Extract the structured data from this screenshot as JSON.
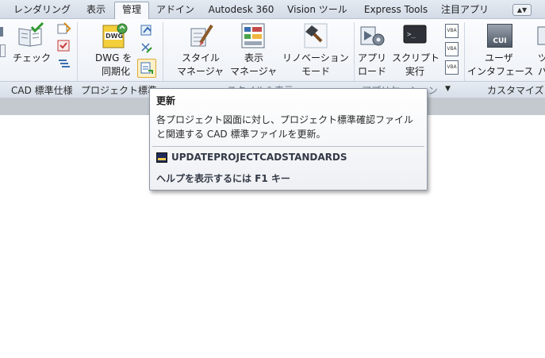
{
  "tabs": [
    {
      "label": "レンダリング",
      "active": false
    },
    {
      "label": "表示",
      "active": false
    },
    {
      "label": "管理",
      "active": true
    },
    {
      "label": "アドイン",
      "active": false
    },
    {
      "label": "Autodesk 360",
      "active": false
    },
    {
      "label": "Vision ツール",
      "active": false
    },
    {
      "label": "Express Tools",
      "active": false
    },
    {
      "label": "注目アプリ",
      "active": false
    }
  ],
  "tab_menu_glyph": "▲▼",
  "ribbon": {
    "check_label": "チェック",
    "dwg_label_1": "DWG を",
    "dwg_label_2": "同期化",
    "style_manager_1": "スタイル",
    "style_manager_2": "マネージャ",
    "display_manager_1": "表示",
    "display_manager_2": "マネージャ",
    "renovation_1": "リノベーション",
    "renovation_2": "モード",
    "app_load_1": "アプリ",
    "app_load_2": "ロード",
    "script_1": "スクリプト",
    "script_2": "実行",
    "vba_label": "VBA",
    "cui_icon_text": "CUI",
    "user_interface_1": "ユーザ",
    "user_interface_2": "インタフェース",
    "partial_1": "ツ",
    "partial_2": "パ"
  },
  "panels": {
    "cad_standards": "CAD 標準仕様",
    "project_standards": "プロジェクト標準",
    "style_display": "スタイル＆表示",
    "applications": "アプリケーション",
    "applications_arrow": "▼",
    "customize": "カスタマイズ"
  },
  "tooltip": {
    "title": "更新",
    "description": "各プロジェクト図面に対し、プロジェクト標準確認ファイルと関連する CAD 標準ファイルを更新。",
    "command": "UPDATEPROJECTCADSTANDARDS",
    "help": "ヘルプを表示するには F1 キー"
  },
  "colors": {
    "accent": "#3a6fb0",
    "tooltip_border": "#8d97a6"
  }
}
